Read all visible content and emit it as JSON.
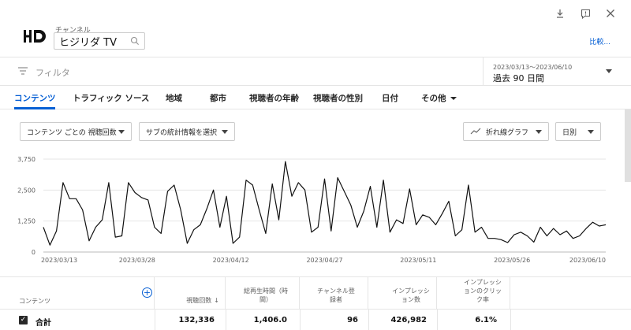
{
  "channel": {
    "label": "チャンネル",
    "name": "ヒジリダ TV",
    "compare": "比較..."
  },
  "filter": {
    "placeholder": "フィルタ"
  },
  "date": {
    "range": "2023/03/13～2023/06/10",
    "label": "過去 90 日間"
  },
  "tabs": [
    {
      "label": "コンテンツ",
      "active": true
    },
    {
      "label": "トラフィック ソース"
    },
    {
      "label": "地域"
    },
    {
      "label": "都市"
    },
    {
      "label": "視聴者の年齢"
    },
    {
      "label": "視聴者の性別"
    },
    {
      "label": "日付"
    },
    {
      "label": "その他"
    }
  ],
  "dropdowns": {
    "metric": "コンテンツ ごとの 視聴回数",
    "secondary": "サブの統計情報を選択",
    "chart_type": "折れ線グラフ",
    "interval": "日別"
  },
  "table": {
    "content_col": "コンテンツ",
    "headers": [
      "視聴回数",
      "総再生時間（時間）",
      "チャンネル登録者",
      "インプレッション数",
      "インプレッションのクリック率"
    ],
    "total_label": "合計",
    "total_values": [
      "132,336",
      "1,406.0",
      "96",
      "426,982",
      "6.1%"
    ]
  },
  "chart_data": {
    "type": "line",
    "x_ticks": [
      "2023/03/13",
      "2023/03/28",
      "2023/04/12",
      "2023/04/27",
      "2023/05/11",
      "2023/05/26",
      "2023/06/10"
    ],
    "y_ticks": [
      "3,750",
      "2,500",
      "1,250",
      "0"
    ],
    "ylim": [
      0,
      3750
    ],
    "grid": true,
    "values": [
      1000,
      280,
      850,
      2800,
      2150,
      2150,
      1700,
      450,
      1000,
      1300,
      2800,
      600,
      650,
      2800,
      2400,
      2200,
      2100,
      1000,
      750,
      2450,
      2700,
      1700,
      350,
      900,
      1100,
      1750,
      2500,
      1000,
      2250,
      350,
      600,
      2900,
      2700,
      1700,
      750,
      2750,
      1300,
      3650,
      2250,
      2800,
      2500,
      800,
      1000,
      2950,
      850,
      3000,
      2450,
      1900,
      1000,
      1650,
      2650,
      1000,
      2900,
      800,
      1300,
      1150,
      2550,
      1100,
      1500,
      1400,
      1100,
      1550,
      2050,
      650,
      900,
      2700,
      800,
      1000,
      550,
      550,
      500,
      380,
      700,
      800,
      650,
      400,
      1000,
      650,
      950,
      700,
      850,
      550,
      650,
      950,
      1200,
      1050,
      1100
    ]
  }
}
